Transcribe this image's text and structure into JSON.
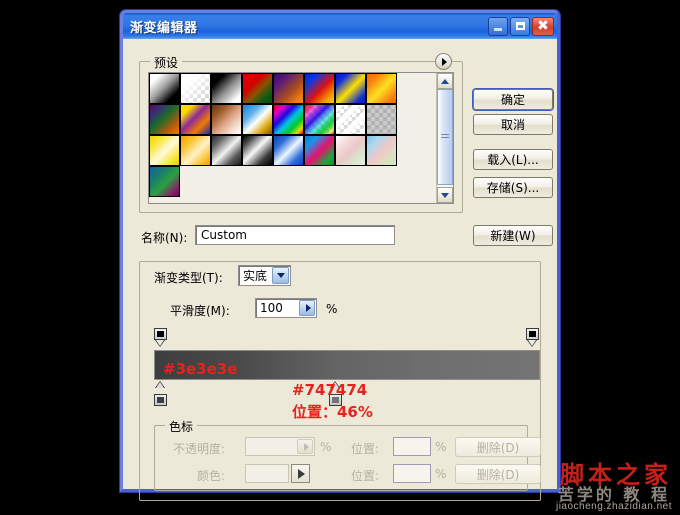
{
  "window": {
    "title": "渐变编辑器",
    "buttons": {
      "minimize": "minimize-button",
      "maximize": "maximize-button",
      "close": "close-button"
    }
  },
  "presets": {
    "legend": "预设",
    "menu_icon": "preset-menu-arrow",
    "swatches": [
      {
        "name": "foreground-to-background",
        "css": "linear-gradient(135deg,#ffffff 0%,#ffffff 18%,#9a9a9a 48%,#000000 78%,#000000 100%)"
      },
      {
        "name": "foreground-to-transparent",
        "checker": true,
        "css": "linear-gradient(135deg,rgba(255,255,255,1) 0%,rgba(255,255,255,1) 25%,rgba(255,255,255,0) 95%)"
      },
      {
        "name": "black-white",
        "css": "linear-gradient(135deg,#000000 0%,#000000 22%,#8a8a8a 52%,#ffffff 86%,#ffffff 100%)"
      },
      {
        "name": "red-green",
        "css": "linear-gradient(135deg,#e00000 0%,#d40000 35%,#8a5200 55%,#0b5c14 80%,#064c10 100%)"
      },
      {
        "name": "violet-orange",
        "css": "linear-gradient(135deg,#3a0a6b 0%,#5a1a7a 25%,#a64b1f 60%,#f07a10 85%,#f58a12 100%)"
      },
      {
        "name": "blue-red-yellow",
        "css": "linear-gradient(135deg,#0024c8 0%,#0b3ae0 22%,#e01010 55%,#f0a000 82%,#ffd000 100%)"
      },
      {
        "name": "blue-yellow-blue",
        "css": "linear-gradient(135deg,#0a18c0 0%,#1030d8 20%,#ffe000 52%,#1030d8 84%,#0a18c0 100%)"
      },
      {
        "name": "orange-yellow-orange",
        "css": "linear-gradient(135deg,#f07000 0%,#f58010 20%,#ffe020 52%,#f58010 84%,#f07000 100%)"
      },
      {
        "name": "violet-green-orange",
        "css": "linear-gradient(135deg,#5b0b5b 0%,#3a2a7a 20%,#1a6b2a 45%,#b05a10 75%,#f08000 100%)"
      },
      {
        "name": "yellow-violet-orange-blue",
        "css": "linear-gradient(135deg,#ffd800 0%,#ffd800 20%,#8a2a9a 45%,#f07a00 70%,#1a2ab0 100%)"
      },
      {
        "name": "copper",
        "css": "linear-gradient(135deg,#6a3510 0%,#9a5a28 25%,#e0a888 55%,#f6e2d4 80%,#ffffff 100%)"
      },
      {
        "name": "chrome",
        "css": "linear-gradient(135deg,#1a82d8 0%,#5fb0ea 30%,#ffffff 52%,#d8a400 78%,#7a5a00 100%)"
      },
      {
        "name": "spectrum",
        "css": "linear-gradient(135deg,#e00000 0%,#e000c8 18%,#2000e0 36%,#00c8e0 54%,#00c828 72%,#e0e000 88%,#e00000 100%)"
      },
      {
        "name": "transparent-rainbow",
        "checker": true,
        "css": "linear-gradient(135deg,rgba(224,0,0,0.95) 0%,rgba(224,0,200,0.6) 20%,rgba(32,0,224,0.9) 40%,rgba(0,200,224,0.55) 58%,rgba(0,200,40,0.9) 76%,rgba(224,224,0,0.5) 92%,rgba(224,0,0,0.9) 100%)"
      },
      {
        "name": "transparent-stripes",
        "checker": true,
        "css": "repeating-linear-gradient(135deg,rgba(255,255,255,0.92) 0 6px,rgba(255,255,255,0.25) 6px 12px)"
      },
      {
        "name": "transparent-checker",
        "checker": true,
        "css": "linear-gradient(rgba(140,140,140,0.45),rgba(140,140,140,0.45))"
      },
      {
        "name": "yellow-white-yellow",
        "css": "linear-gradient(135deg,#f0d800 0%,#f8e840 25%,#fffadf 52%,#f8e840 78%,#e8cc00 100%)"
      },
      {
        "name": "orange-yellow-white",
        "css": "linear-gradient(135deg,#f8a000 0%,#fcc63c 28%,#fff2c8 55%,#fbc53a 80%,#f39a00 100%)"
      },
      {
        "name": "steel-bar",
        "css": "linear-gradient(135deg,#2a2a2a 0%,#6a6a6a 22%,#f2f2f2 50%,#5a5a5a 76%,#1a1a1a 100%)"
      },
      {
        "name": "silver-black",
        "css": "linear-gradient(135deg,#000000 0%,#4a4a4a 18%,#f8f8f8 46%,#3a3a3a 76%,#000000 100%)"
      },
      {
        "name": "blue-white-blue",
        "css": "linear-gradient(135deg,#0d3fb0 0%,#2f6fd8 25%,#eef6ff 52%,#2f6fd8 78%,#0d3fb0 100%)"
      },
      {
        "name": "blue-magenta-green",
        "css": "linear-gradient(135deg,#0a7fd8 0%,#1a95ea 22%,#e81070 52%,#1aa838 82%,#0d8c2a 100%)"
      },
      {
        "name": "pastel-pink-green",
        "css": "linear-gradient(135deg,#ffffff 0%,#f6dede 25%,#eac8c8 50%,#d8e8d0 78%,#e8f0e2 100%)"
      },
      {
        "name": "pastel-blue-pink",
        "css": "linear-gradient(135deg,#78c4ea 0%,#a8d8f0 22%,#f0c8c8 52%,#d8e4c0 80%,#cfe8c0 100%)"
      },
      {
        "name": "blue-green-magenta",
        "css": "linear-gradient(135deg,#1a5fa8 0%,#1a7f6a 30%,#2aa040 55%,#8a1a6a 85%,#5a1050 100%)"
      }
    ],
    "scrollbar": {
      "up": "scroll-up-arrow",
      "down": "scroll-down-arrow",
      "thumb": "scroll-thumb"
    }
  },
  "actions": {
    "ok": "确定",
    "cancel": "取消",
    "load": "载入(L)...",
    "save": "存储(S)...",
    "new": "新建(W)"
  },
  "name_field": {
    "label": "名称(N):",
    "value": "Custom"
  },
  "gradient_type": {
    "label": "渐变类型(T):",
    "value": "实底"
  },
  "smoothness": {
    "label": "平滑度(M):",
    "value": "100",
    "unit": "%"
  },
  "gradient": {
    "css": "linear-gradient(to right,#3e3e3e 0%,#4a4a4a 22%,#636363 46%,#6e6e6e 70%,#747474 100%)",
    "opacity_stops": [
      {
        "name": "opacity-stop-left",
        "position_pct": 0
      },
      {
        "name": "opacity-stop-right",
        "position_pct": 100
      }
    ],
    "color_stops": [
      {
        "name": "color-stop-left",
        "position_pct": 0,
        "color": "#3e3e3e"
      },
      {
        "name": "color-stop-middle",
        "position_pct": 46,
        "color": "#747474"
      }
    ]
  },
  "annotations": {
    "left_color": "#3e3e3e",
    "mid_color": "#747474",
    "position": "位置：46%"
  },
  "color_stops_panel": {
    "legend": "色标",
    "opacity_label": "不透明度:",
    "opacity_value": "",
    "opacity_unit": "%",
    "opacity_position_label": "位置:",
    "opacity_position_value": "",
    "opacity_position_unit": "%",
    "opacity_delete": "删除(D)",
    "color_label": "颜色:",
    "color_position_label": "位置:",
    "color_position_value": "",
    "color_position_unit": "%",
    "color_delete": "删除(D)"
  },
  "watermark": {
    "main": "脚本之家",
    "sub": "苦学的 教 程",
    "url": "jiaocheng.zhazidian.net"
  }
}
